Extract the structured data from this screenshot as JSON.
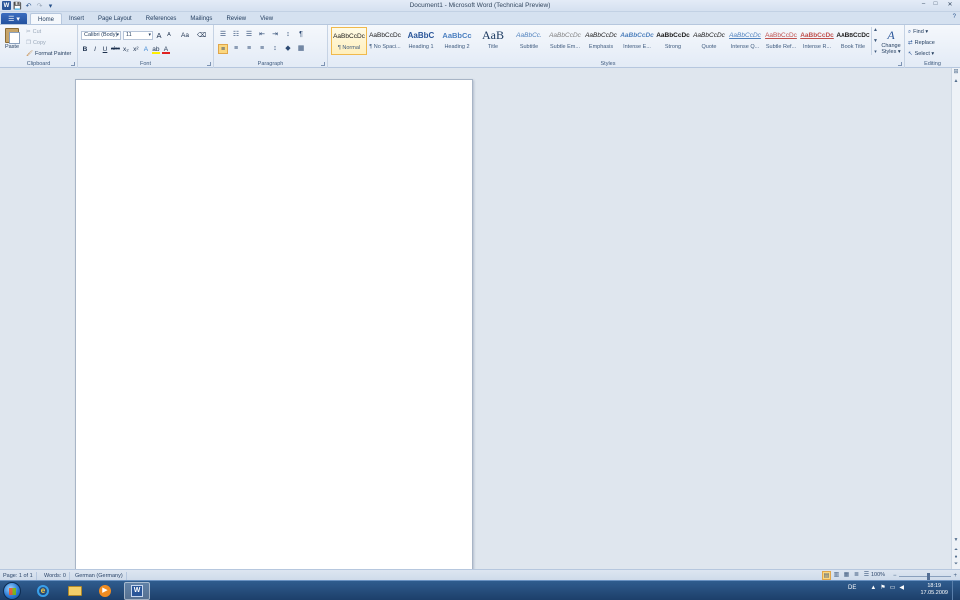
{
  "window": {
    "title": "Document1 - Microsoft Word (Technical Preview)",
    "minimize": "–",
    "maximize": "□",
    "close": "✕"
  },
  "qat": {
    "app_icon": "W",
    "save": "💾",
    "undo": "↶",
    "redo": "↷",
    "customize": "▾"
  },
  "tabs": {
    "file_button": "☰ ▾",
    "items": [
      "Home",
      "Insert",
      "Page Layout",
      "References",
      "Mailings",
      "Review",
      "View"
    ],
    "help": "?"
  },
  "clipboard": {
    "paste": "Paste",
    "cut": "Cut",
    "copy": "Copy",
    "format_painter": "Format Painter",
    "label": "Clipboard"
  },
  "font": {
    "family": "Calibri (Body)",
    "size": "11",
    "grow": "A",
    "shrink": "A",
    "change_case": "Aa",
    "clear": "⌫",
    "bold": "B",
    "italic": "I",
    "underline": "U",
    "strike": "abc",
    "subscript": "x₂",
    "superscript": "x²",
    "effects": "A",
    "highlight": "ab",
    "color": "A",
    "label": "Font"
  },
  "paragraph": {
    "bullets": "☰",
    "numbering": "☷",
    "multilevel": "☰",
    "decrease_indent": "⇤",
    "increase_indent": "⇥",
    "sort": "↕",
    "show_marks": "¶",
    "align_left": "≡",
    "center": "≡",
    "align_right": "≡",
    "justify": "≡",
    "line_spacing": "↕",
    "shading": "◆",
    "borders": "▦",
    "label": "Paragraph"
  },
  "styles": {
    "items": [
      {
        "sample": "AaBbCcDc",
        "name": "¶ Normal"
      },
      {
        "sample": "AaBbCcDc",
        "name": "¶ No Spaci..."
      },
      {
        "sample": "AaBbC",
        "name": "Heading 1"
      },
      {
        "sample": "AaBbCc",
        "name": "Heading 2"
      },
      {
        "sample": "AaB",
        "name": "Title"
      },
      {
        "sample": "AaBbCc.",
        "name": "Subtitle"
      },
      {
        "sample": "AaBbCcDc",
        "name": "Subtle Em..."
      },
      {
        "sample": "AaBbCcDc",
        "name": "Emphasis"
      },
      {
        "sample": "AaBbCcDc",
        "name": "Intense E..."
      },
      {
        "sample": "AaBbCcDc",
        "name": "Strong"
      },
      {
        "sample": "AaBbCcDc",
        "name": "Quote"
      },
      {
        "sample": "AaBbCcDc",
        "name": "Intense Q..."
      },
      {
        "sample": "AaBbCcDc",
        "name": "Subtle Ref..."
      },
      {
        "sample": "AaBbCcDc",
        "name": "Intense R..."
      },
      {
        "sample": "AaBbCcDc",
        "name": "Book Title"
      }
    ],
    "change_styles_line1": "Change",
    "change_styles_line2": "Styles ▾",
    "label": "Styles"
  },
  "editing": {
    "find": "Find ▾",
    "replace": "Replace",
    "select": "Select ▾",
    "label": "Editing"
  },
  "statusbar": {
    "page": "Page: 1 of 1",
    "words": "Words: 0",
    "language": "German (Germany)",
    "zoom": "100%",
    "zoom_out": "−",
    "zoom_in": "+"
  },
  "taskbar": {
    "language": "DE",
    "time": "18:19",
    "date": "17.05.2009"
  },
  "colors": {
    "accent": "#2a5699",
    "ribbon_bg": "#e3ebf6",
    "doc_bg": "#dfe6ee",
    "active_highlight": "#fbd77f"
  }
}
